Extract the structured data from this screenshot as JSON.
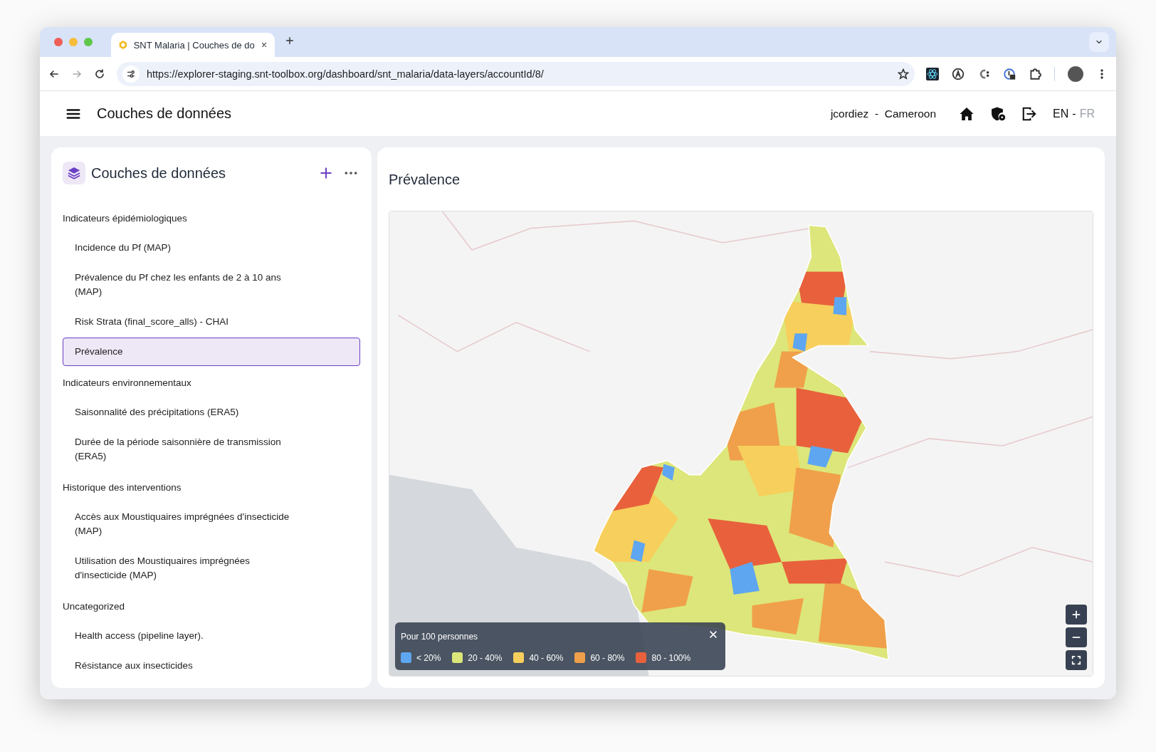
{
  "browser": {
    "tab_title": "SNT Malaria | Couches de do",
    "url": "https://explorer-staging.snt-toolbox.org/dashboard/snt_malaria/data-layers/accountId/8/"
  },
  "header": {
    "title": "Couches de données",
    "user": "jcordiez",
    "separator": "-",
    "account": "Cameroon",
    "languages": [
      {
        "label": "EN",
        "selected": true
      },
      {
        "label": "FR",
        "selected": false
      }
    ],
    "language_separator": "-"
  },
  "sidebar": {
    "title": "Couches de données",
    "groups": [
      {
        "title": "Indicateurs épidémiologiques",
        "items": [
          {
            "label": "Incidence du Pf (MAP)",
            "selected": false
          },
          {
            "label": "Prévalence du Pf chez les enfants de 2 à 10 ans (MAP)",
            "selected": false
          },
          {
            "label": "Risk Strata (final_score_alls) - CHAI",
            "selected": false
          },
          {
            "label": "Prévalence",
            "selected": true
          }
        ]
      },
      {
        "title": "Indicateurs environnementaux",
        "items": [
          {
            "label": "Saisonnalité des précipitations (ERA5)",
            "selected": false
          },
          {
            "label": "Durée de la période saisonnière de transmission (ERA5)",
            "selected": false
          }
        ]
      },
      {
        "title": "Historique des interventions",
        "items": [
          {
            "label": "Accès aux Moustiquaires imprégnées d'insecticide (MAP)",
            "selected": false
          },
          {
            "label": "Utilisation des Moustiquaires imprégnées d'insecticide (MAP)",
            "selected": false
          }
        ]
      },
      {
        "title": "Uncategorized",
        "items": [
          {
            "label": "Health access (pipeline layer).",
            "selected": false
          },
          {
            "label": "Résistance aux insecticides",
            "selected": false
          }
        ]
      }
    ]
  },
  "main": {
    "title": "Prévalence",
    "legend": {
      "title": "Pour 100 personnes",
      "items": [
        {
          "label": "< 20%",
          "color": "#5ea6f0"
        },
        {
          "label": "20 - 40%",
          "color": "#dde67a"
        },
        {
          "label": "40 - 60%",
          "color": "#f7cf5c"
        },
        {
          "label": "60 - 80%",
          "color": "#f0a04a"
        },
        {
          "label": "80 - 100%",
          "color": "#e8613c"
        }
      ]
    }
  }
}
